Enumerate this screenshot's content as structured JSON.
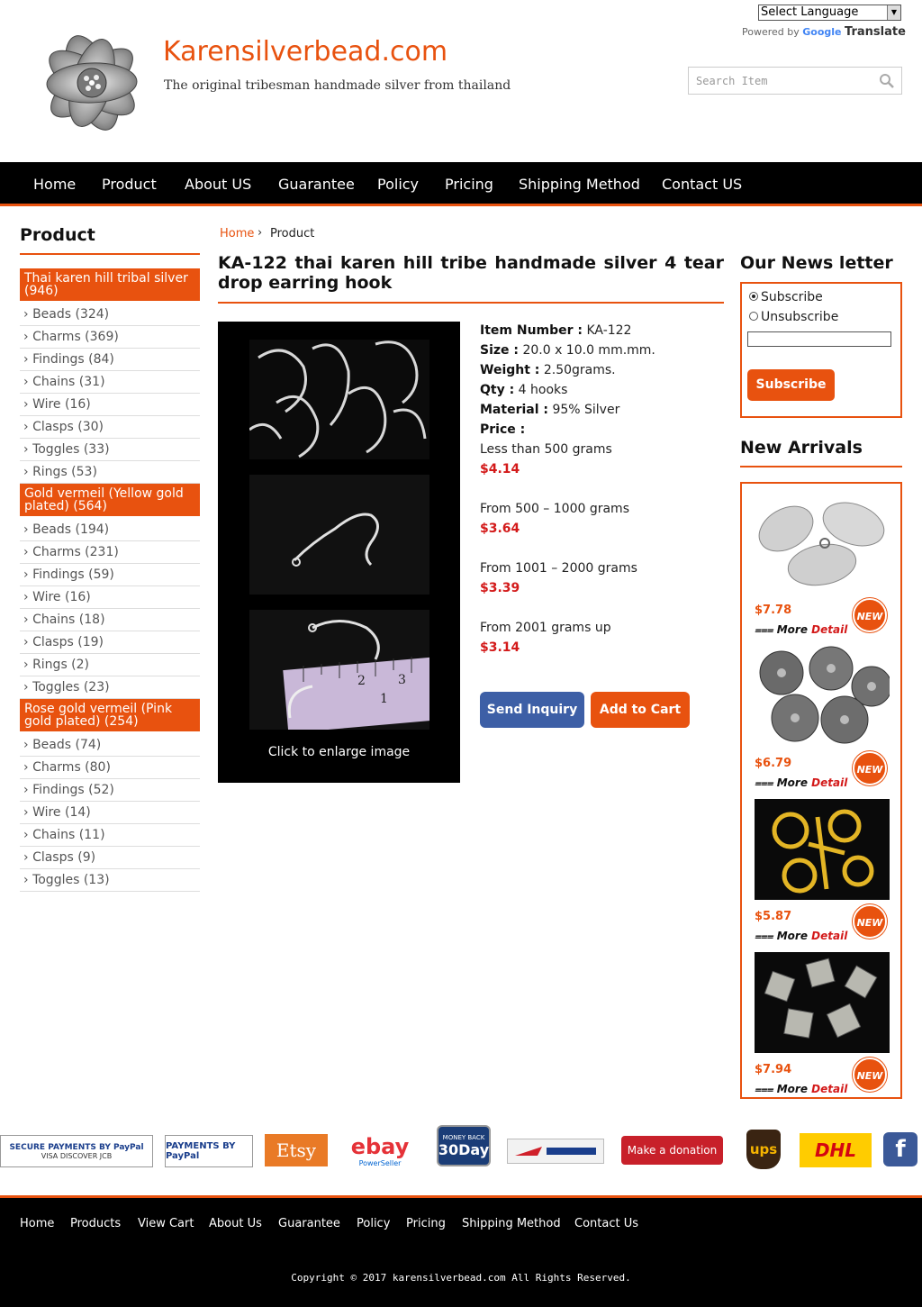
{
  "header": {
    "site_title": "Karensilverbead.com",
    "tagline": "The original tribesman handmade silver from thailand",
    "language_select": "Select Language",
    "powered_by": "Powered by",
    "google": "Google",
    "translate": "Translate",
    "search_placeholder": "Search Item"
  },
  "nav": [
    "Home",
    "Product",
    "About US",
    "Guarantee",
    "Policy",
    "Pricing",
    "Shipping Method",
    "Contact US"
  ],
  "sidebar": {
    "title": "Product",
    "groups": [
      {
        "label": "Thai karen hill tribal silver (946)",
        "items": [
          "Beads (324)",
          "Charms (369)",
          "Findings (84)",
          "Chains (31)",
          "Wire (16)",
          "Clasps (30)",
          "Toggles (33)",
          "Rings (53)"
        ]
      },
      {
        "label": "Gold vermeil (Yellow gold plated) (564)",
        "items": [
          "Beads (194)",
          "Charms (231)",
          "Findings (59)",
          "Wire (16)",
          "Chains (18)",
          "Clasps (19)",
          "Rings (2)",
          "Toggles (23)"
        ]
      },
      {
        "label": "Rose gold vermeil (Pink gold plated) (254)",
        "items": [
          "Beads (74)",
          "Charms (80)",
          "Findings (52)",
          "Wire (14)",
          "Chains (11)",
          "Clasps (9)",
          "Toggles (13)"
        ]
      }
    ]
  },
  "breadcrumb": {
    "home": "Home",
    "separator": "›",
    "current": "Product"
  },
  "product": {
    "title": "KA-122 thai karen hill tribe handmade silver 4 tear drop earring hook",
    "enlarge_text": "Click to enlarge image",
    "specs": [
      {
        "label": "Item Number :",
        "value": "KA-122"
      },
      {
        "label": "Size :",
        "value": "20.0 x 10.0 mm.mm."
      },
      {
        "label": "Weight :",
        "value": "2.50grams."
      },
      {
        "label": "Qty :",
        "value": "4 hooks"
      },
      {
        "label": "Material :",
        "value": "95% Silver"
      },
      {
        "label": "Price :",
        "value": ""
      }
    ],
    "tiers": [
      {
        "range": "Less than 500 grams",
        "price": "$4.14"
      },
      {
        "range": "From 500 – 1000 grams",
        "price": "$3.64"
      },
      {
        "range": "From 1001 – 2000 grams",
        "price": "$3.39"
      },
      {
        "range": "From 2001 grams up",
        "price": "$3.14"
      }
    ],
    "inquiry_label": "Send Inquiry",
    "cart_label": "Add to Cart"
  },
  "newsletter": {
    "title": "Our News letter",
    "subscribe_option": "Subscribe",
    "unsubscribe_option": "Unsubscribe",
    "button": "Subscribe"
  },
  "arrivals": {
    "title": "New Arrivals",
    "items": [
      {
        "price": "$7.78",
        "more": "More",
        "detail": "Detail",
        "badge": "NEW"
      },
      {
        "price": "$6.79",
        "more": "More",
        "detail": "Detail",
        "badge": "NEW"
      },
      {
        "price": "$5.87",
        "more": "More",
        "detail": "Detail",
        "badge": "NEW"
      },
      {
        "price": "$7.94",
        "more": "More",
        "detail": "Detail",
        "badge": "NEW"
      }
    ]
  },
  "payments": {
    "paypal_secure": "SECURE PAYMENTS BY PayPal",
    "paypal_cards": "VISA  DISCOVER  JCB",
    "paypal_payments": "PAYMENTS BY PayPal",
    "etsy": "Etsy",
    "ebay": "ebay",
    "ebay_sub": "PowerSeller",
    "moneyback": "30Day",
    "moneyback_sub": "MONEY BACK",
    "donation": "Make a donation",
    "ups": "ups",
    "dhl": "DHL",
    "facebook": "f"
  },
  "footer": {
    "links": [
      "Home",
      "Products",
      "View Cart",
      "About Us",
      "Guarantee",
      "Policy",
      "Pricing",
      "Shipping Method",
      "Contact Us"
    ],
    "copyright": "Copyright © 2017 karensilverbead.com All Rights Reserved."
  },
  "colors": {
    "accent": "#e8520f",
    "nav_bg": "#000000",
    "price_red": "#d31a1a",
    "inquiry_blue": "#3d5fa6"
  }
}
